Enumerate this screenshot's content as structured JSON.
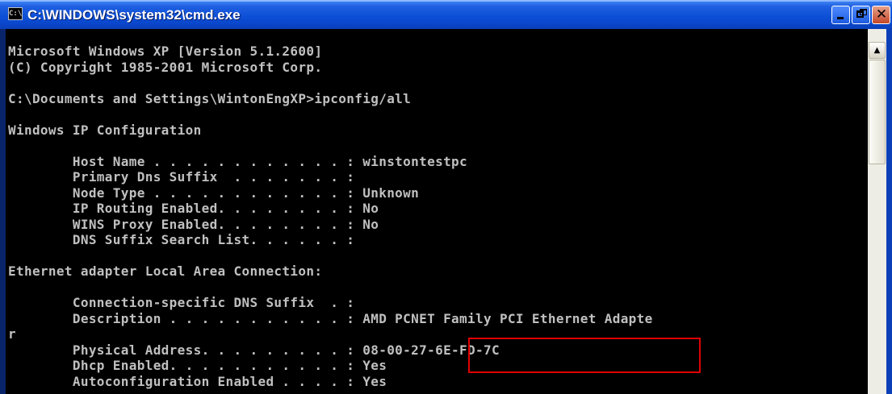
{
  "window": {
    "title": "C:\\WINDOWS\\system32\\cmd.exe",
    "icon": "cmd-icon",
    "controls": [
      "minimize-icon",
      "maximize-icon",
      "close-icon"
    ]
  },
  "console": {
    "lines": [
      "Microsoft Windows XP [Version 5.1.2600]",
      "(C) Copyright 1985-2001 Microsoft Corp.",
      "",
      "C:\\Documents and Settings\\WintonEngXP>ipconfig/all",
      "",
      "Windows IP Configuration",
      "",
      "        Host Name . . . . . . . . . . . . : winstontestpc",
      "        Primary Dns Suffix  . . . . . . . :",
      "        Node Type . . . . . . . . . . . . : Unknown",
      "        IP Routing Enabled. . . . . . . . : No",
      "        WINS Proxy Enabled. . . . . . . . : No",
      "        DNS Suffix Search List. . . . . . :",
      "",
      "Ethernet adapter Local Area Connection:",
      "",
      "        Connection-specific DNS Suffix  . :",
      "        Description . . . . . . . . . . . : AMD PCNET Family PCI Ethernet Adapte",
      "r",
      "        Physical Address. . . . . . . . . : 08-00-27-6E-FD-7C",
      "        Dhcp Enabled. . . . . . . . . . . : Yes",
      "        Autoconfiguration Enabled . . . . : Yes"
    ]
  },
  "scrollbar": {
    "up_icon": "scroll-up-arrow-icon"
  },
  "annotation": {
    "highlighted_value": "08-00-27-6E-FD-7C",
    "color": "#e00000"
  },
  "colors": {
    "console_bg": "#000000",
    "console_text": "#c0c0c0",
    "titlebar": "#0c4fd6"
  }
}
